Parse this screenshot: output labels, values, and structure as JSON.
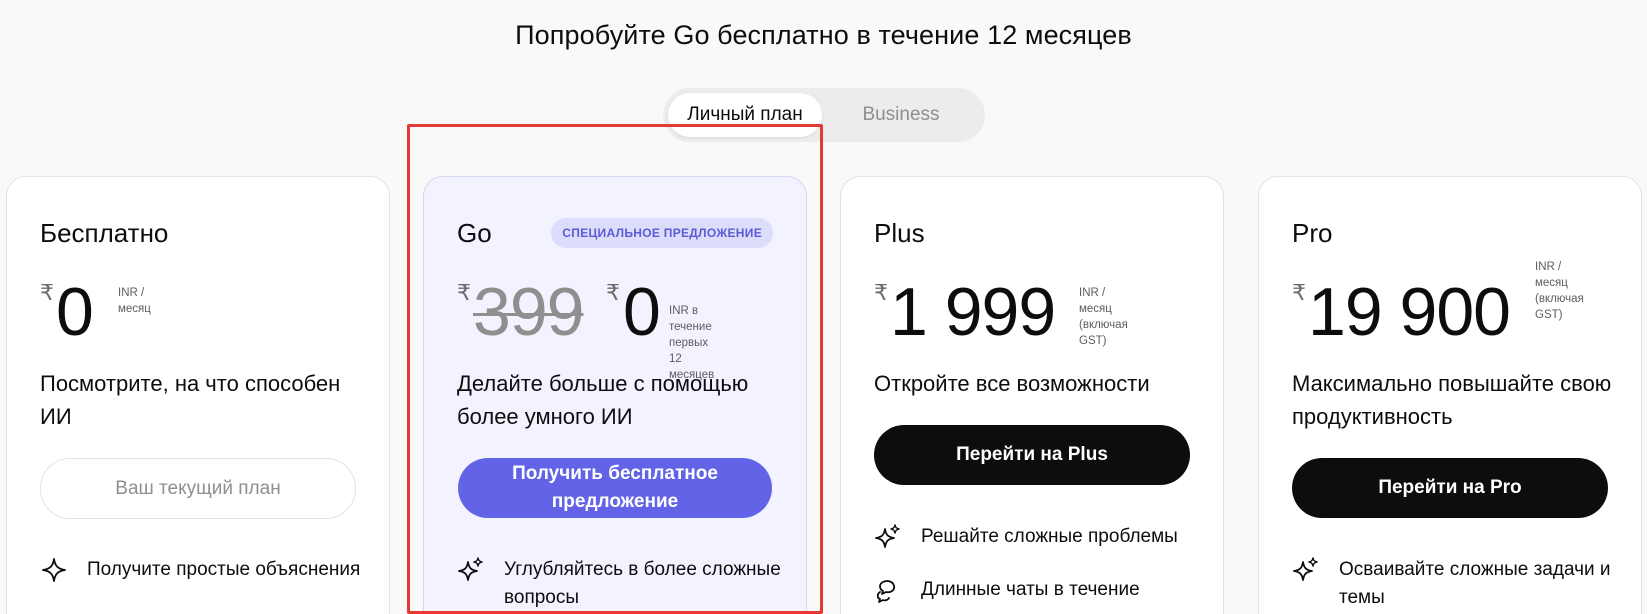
{
  "header": {
    "title": "Попробуйте Go бесплатно в течение 12 месяцев"
  },
  "toggle": {
    "personal_label": "Личный план",
    "business_label": "Business"
  },
  "cards": {
    "free": {
      "name": "Бесплатно",
      "currency_symbol": "₹",
      "price": "0",
      "price_note_1": "INR /",
      "price_note_2": "месяц",
      "tagline": "Посмотрите, на что способен ИИ",
      "button": "Ваш текущий план",
      "feature_1": "Получите простые объяснения"
    },
    "go": {
      "name": "Go",
      "badge": "СПЕЦИАЛЬНОЕ ПРЕДЛОЖЕНИЕ",
      "currency_symbol": "₹",
      "old_price": "399",
      "price": "0",
      "price_note_1": "INR в течение",
      "price_note_2": "первых 12 месяцев",
      "tagline": "Делайте больше с помощью более умного ИИ",
      "button": "Получить бесплатное предложение",
      "feature_1": "Углубляйтесь в более сложные вопросы"
    },
    "plus": {
      "name": "Plus",
      "currency_symbol": "₹",
      "price": "1 999",
      "price_note_1": "INR /",
      "price_note_2": "месяц (включая",
      "price_note_3": "GST)",
      "tagline": "Откройте все возможности",
      "button": "Перейти на Plus",
      "feature_1": "Решайте сложные проблемы",
      "feature_2": "Длинные чаты в течение"
    },
    "pro": {
      "name": "Pro",
      "currency_symbol": "₹",
      "price": "19 900",
      "price_note_1": "INR /",
      "price_note_2": "месяц",
      "price_note_3": "(включая",
      "price_note_4": "GST)",
      "tagline": "Максимально повышайте свою продуктивность",
      "button": "Перейти на Pro",
      "feature_1": "Осваивайте сложные задачи и темы"
    }
  },
  "colors": {
    "accent": "#6363e8",
    "badge_bg": "#dcdcfb",
    "go_card_bg": "#f3f3ff",
    "highlight": "#e53935",
    "primary_button": "#0d0d0d"
  },
  "icons": {
    "sparkle": "sparkle-icon",
    "sparkles": "sparkles-icon",
    "chat": "chat-bubbles-icon"
  }
}
